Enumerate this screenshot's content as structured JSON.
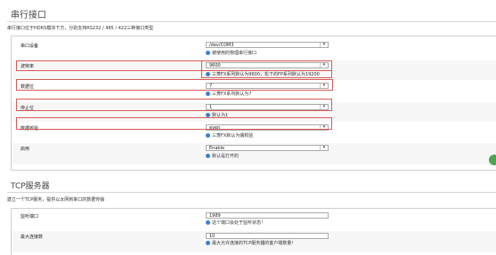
{
  "serial": {
    "title": "串行接口",
    "description": "串行接口位于HDRS模块下方，分别支持RS232 / 485 / 422三种接口类型",
    "rows": [
      {
        "label": "串口设备",
        "value": "/dev/COM3",
        "hint": "被使用的物理串行接口"
      },
      {
        "label": "波特率",
        "value": "9600",
        "hint": "三菱FX系列默认为9600，松下的FP系列默认为19200"
      },
      {
        "label": "数据位",
        "value": "7",
        "hint": "三菱FX系列默认为7"
      },
      {
        "label": "停止位",
        "value": "1",
        "hint": "默认为1"
      },
      {
        "label": "数据校验",
        "value": "even",
        "hint": "三菱FX默认为偶校验"
      },
      {
        "label": "启用",
        "value": "Enable",
        "hint": "默认是打开的"
      }
    ]
  },
  "tcp": {
    "title": "TCP服务器",
    "description": "建立一个TCP服务，提供以太网到串口的数据传输",
    "rows": [
      {
        "label": "监听端口",
        "value": "1989",
        "hint": "这个端口会处于监听状态！"
      },
      {
        "label": "最大连接数",
        "value": "10",
        "hint": "最大允许连接的TCP服务器的客户端数量！"
      }
    ]
  },
  "icons": {
    "info": "info-icon",
    "dropdown": "chevron-down-icon",
    "side": "green-circle-button"
  },
  "colors": {
    "highlight": "#d65a5a",
    "info_icon": "#3a7fd5",
    "side_button": "#53a153"
  }
}
